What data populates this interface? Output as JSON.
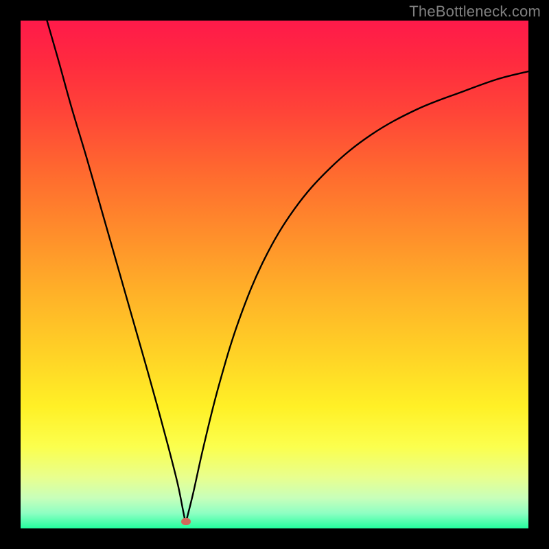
{
  "watermark": "TheBottleneck.com",
  "marker": {
    "x_frac": 0.325,
    "y_frac": 0.987,
    "color": "#d26a5a"
  },
  "chart_data": {
    "type": "line",
    "title": "",
    "xlabel": "",
    "ylabel": "",
    "xlim": [
      0,
      1
    ],
    "ylim": [
      0,
      1
    ],
    "series": [
      {
        "name": "left-branch",
        "x": [
          0.052,
          0.075,
          0.1,
          0.13,
          0.16,
          0.19,
          0.22,
          0.25,
          0.275,
          0.295,
          0.31,
          0.32,
          0.325
        ],
        "y": [
          1.0,
          0.92,
          0.83,
          0.73,
          0.625,
          0.52,
          0.415,
          0.31,
          0.22,
          0.145,
          0.085,
          0.035,
          0.01
        ]
      },
      {
        "name": "right-branch",
        "x": [
          0.325,
          0.34,
          0.36,
          0.39,
          0.43,
          0.48,
          0.54,
          0.61,
          0.69,
          0.78,
          0.87,
          0.94,
          1.0
        ],
        "y": [
          0.01,
          0.07,
          0.16,
          0.28,
          0.41,
          0.53,
          0.63,
          0.71,
          0.775,
          0.825,
          0.86,
          0.885,
          0.9
        ]
      }
    ]
  }
}
